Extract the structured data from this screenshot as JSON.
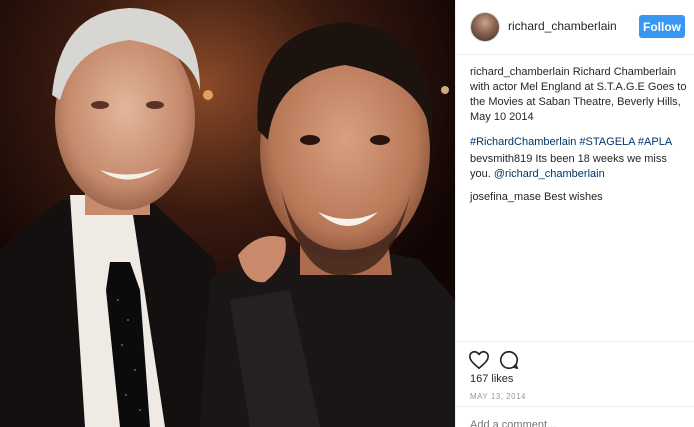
{
  "post": {
    "username": "richard_chamberlain",
    "follow_label": "Follow",
    "caption_author": "richard_chamberlain",
    "caption_text": " Richard Chamberlain with actor Mel England at S.T.A.G.E Goes to the Movies at Saban Theatre, Beverly Hills, May 10 2014",
    "hashtags": "#RichardChamberlain #STAGELA #APLA",
    "likes": "167 likes",
    "date": "MAY 13, 2014",
    "add_comment_placeholder": "Add a comment..."
  },
  "comments": [
    {
      "author": "bevsmith819",
      "text": " Its been 18 weeks we miss you. ",
      "mention": "@richard_chamberlain"
    },
    {
      "author": "josefina_mase",
      "text": " Best wishes",
      "mention": ""
    }
  ],
  "icons": {
    "like": "heart-icon",
    "comment": "comment-icon"
  },
  "colors": {
    "follow_button": "#3897f0",
    "link": "#003569"
  }
}
